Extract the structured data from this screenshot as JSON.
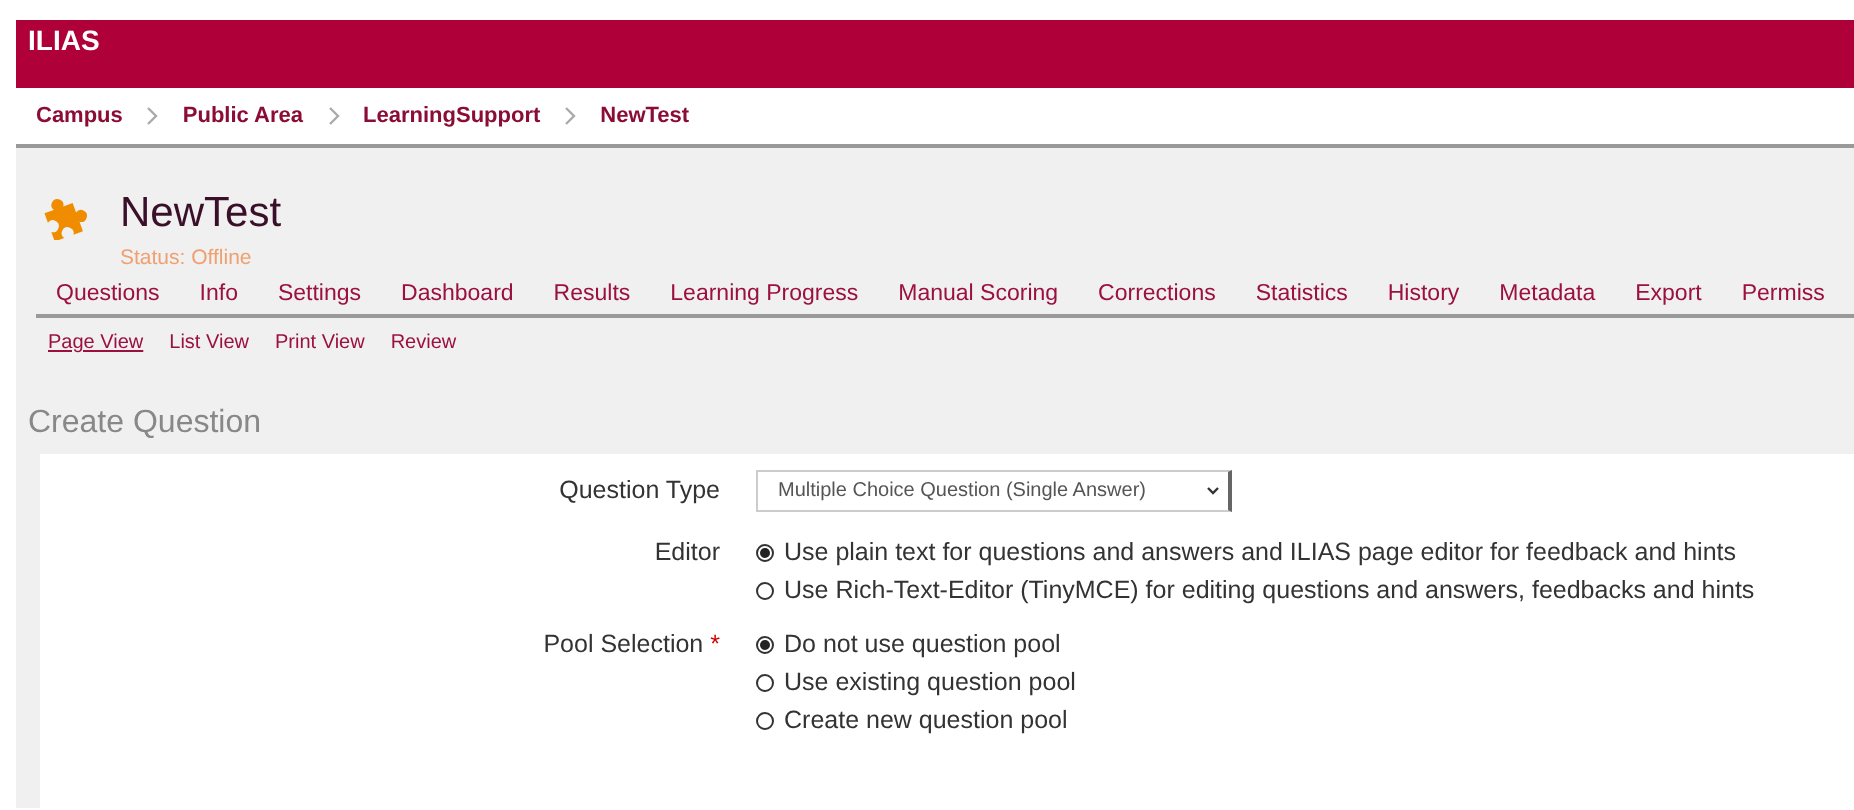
{
  "header": {
    "logo": "ILIAS"
  },
  "breadcrumbs": [
    "Campus",
    "Public Area",
    "LearningSupport",
    "NewTest"
  ],
  "object": {
    "title": "NewTest",
    "status": "Status: Offline"
  },
  "tabs": [
    "Questions",
    "Info",
    "Settings",
    "Dashboard",
    "Results",
    "Learning Progress",
    "Manual Scoring",
    "Corrections",
    "Statistics",
    "History",
    "Metadata",
    "Export",
    "Permiss"
  ],
  "subtabs": [
    {
      "label": "Page View",
      "selected": true
    },
    {
      "label": "List View",
      "selected": false
    },
    {
      "label": "Print View",
      "selected": false
    },
    {
      "label": "Review",
      "selected": false
    }
  ],
  "form": {
    "title": "Create Question",
    "fields": [
      {
        "kind": "select",
        "label": "Question Type",
        "value": "Multiple Choice Question (Single Answer)"
      },
      {
        "kind": "radio",
        "label": "Editor",
        "options": [
          {
            "label": "Use plain text for questions and answers and ILIAS page editor for feedback and hints",
            "selected": true
          },
          {
            "label": "Use Rich-Text-Editor (TinyMCE) for editing questions and answers, feedbacks and hints",
            "selected": false
          }
        ]
      },
      {
        "kind": "radio",
        "label": "Pool Selection",
        "required_mark": "*",
        "options": [
          {
            "label": "Do not use question pool",
            "selected": true
          },
          {
            "label": "Use existing question pool",
            "selected": false
          },
          {
            "label": "Create new question pool",
            "selected": false
          }
        ]
      }
    ]
  }
}
